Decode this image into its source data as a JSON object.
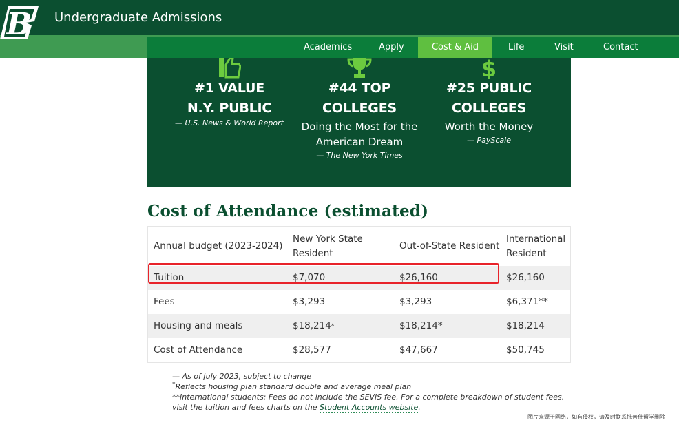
{
  "header": {
    "logo_letter": "B",
    "title": "Undergraduate Admissions"
  },
  "nav": {
    "items": [
      {
        "label": "Academics",
        "active": false
      },
      {
        "label": "Apply",
        "active": false
      },
      {
        "label": "Cost & Aid",
        "active": true
      },
      {
        "label": "Life",
        "active": false
      },
      {
        "label": "Visit",
        "active": false
      },
      {
        "label": "Contact",
        "active": false
      }
    ]
  },
  "hero": {
    "stats": [
      {
        "icon": "thumbs-up-icon",
        "line1": "#1 VALUE",
        "line2": "N.Y. PUBLIC",
        "sub": "",
        "source": "— U.S. News & World Report"
      },
      {
        "icon": "trophy-icon",
        "line1": "#44 TOP",
        "line2": "COLLEGES",
        "sub": "Doing the Most for the American Dream",
        "source": "— The New York Times"
      },
      {
        "icon": "dollar-icon",
        "line1": "#25 PUBLIC",
        "line2": "COLLEGES",
        "sub": "Worth the Money",
        "source": "— PayScale"
      }
    ]
  },
  "cost": {
    "title": "Cost of Attendance (estimated)",
    "headers": [
      "Annual budget (2023-2024)",
      "New York State Resident",
      "Out-of-State Resident",
      "International Resident"
    ],
    "rows": [
      {
        "label": "Tuition",
        "ny": "$7,070",
        "oos": "$26,160",
        "intl": "$26,160"
      },
      {
        "label": "Fees",
        "ny": "$3,293",
        "oos": "$3,293",
        "intl": "$6,371**"
      },
      {
        "label": "Housing and meals",
        "ny": "$18,214",
        "ny_mark": "*",
        "oos": "$18,214*",
        "intl": "$18,214"
      },
      {
        "label": "Cost of Attendance",
        "ny": "$28,577",
        "oos": "$47,667",
        "intl": "$50,745"
      }
    ]
  },
  "notes": {
    "line1": "— As of July 2023, subject to change",
    "line2_mark": "*",
    "line2": "Reflects housing plan standard double and average meal plan",
    "line3": "**International students: Fees do not include the SEVIS fee. For a complete breakdown of student fees,",
    "line4_prefix": "visit the tuition and fees charts on the ",
    "link": "Student Accounts website",
    "line4_suffix": "."
  },
  "credit": "图片来源于网络，如有侵权，请及时联系托普仕留学删除",
  "colors": {
    "dark_green": "#0b4f30",
    "nav_green": "#0b7d3a",
    "active_green": "#5fbf40",
    "icon_green": "#6ccb3f",
    "highlight_red": "#e8232a"
  }
}
